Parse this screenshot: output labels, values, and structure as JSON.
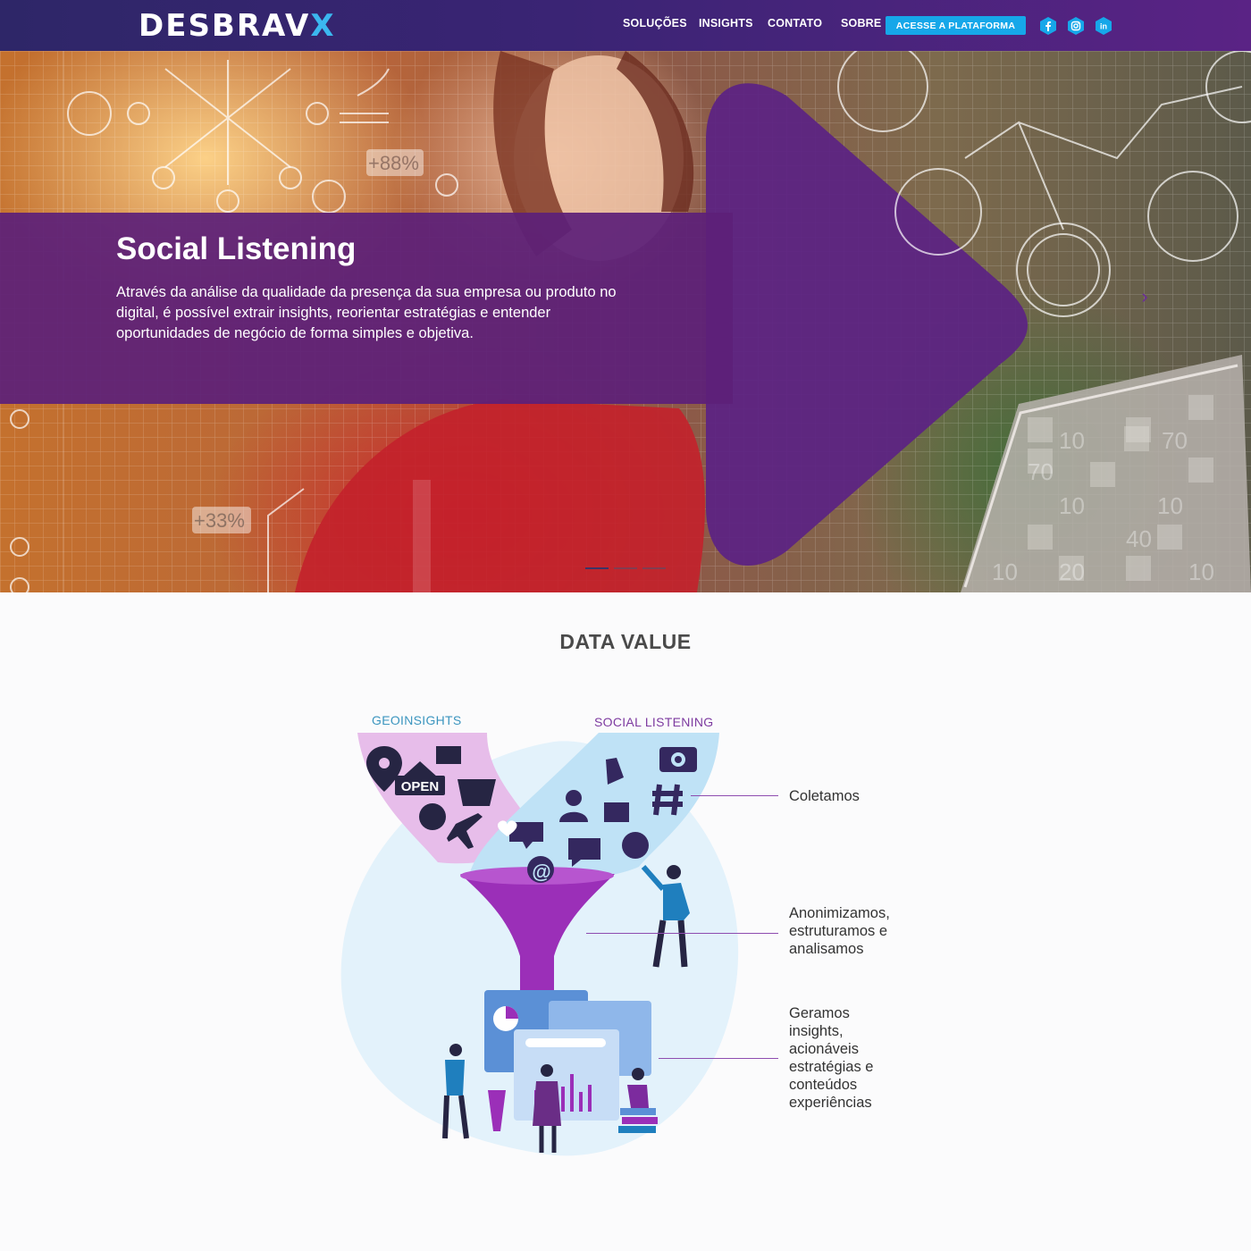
{
  "nav": {
    "logo_main": "DESBRAV",
    "logo_accent": "X",
    "items": [
      "SOLUÇÕES",
      "INSIGHTS",
      "CONTATO",
      "SOBRE"
    ],
    "cta_label": "ACESSE A PLATAFORMA",
    "social": [
      "facebook-icon",
      "instagram-icon",
      "linkedin-icon"
    ],
    "social_color": "#16a7e9"
  },
  "hero": {
    "title": "Social Listening",
    "text": "Através da análise da qualidade da presença da sua empresa ou produto no digital, é possível extrair insights, reorientar estratégias e entender oportunidades de negócio de forma simples e objetiva.",
    "decor_labels": [
      "+88%",
      "+33%"
    ],
    "band_color": "#5c2078",
    "slides_total": 3,
    "slide_active": 1
  },
  "data_value": {
    "title": "DATA VALUE",
    "label_geo": "GEOINSIGHTS",
    "label_social": "SOCIAL LISTENING",
    "geo_sign": "OPEN",
    "steps": [
      "Coletamos",
      "Anonimizamos, estruturamos e analisamos",
      "Geramos insights, acionáveis estratégias e conteúdos experiências"
    ]
  }
}
